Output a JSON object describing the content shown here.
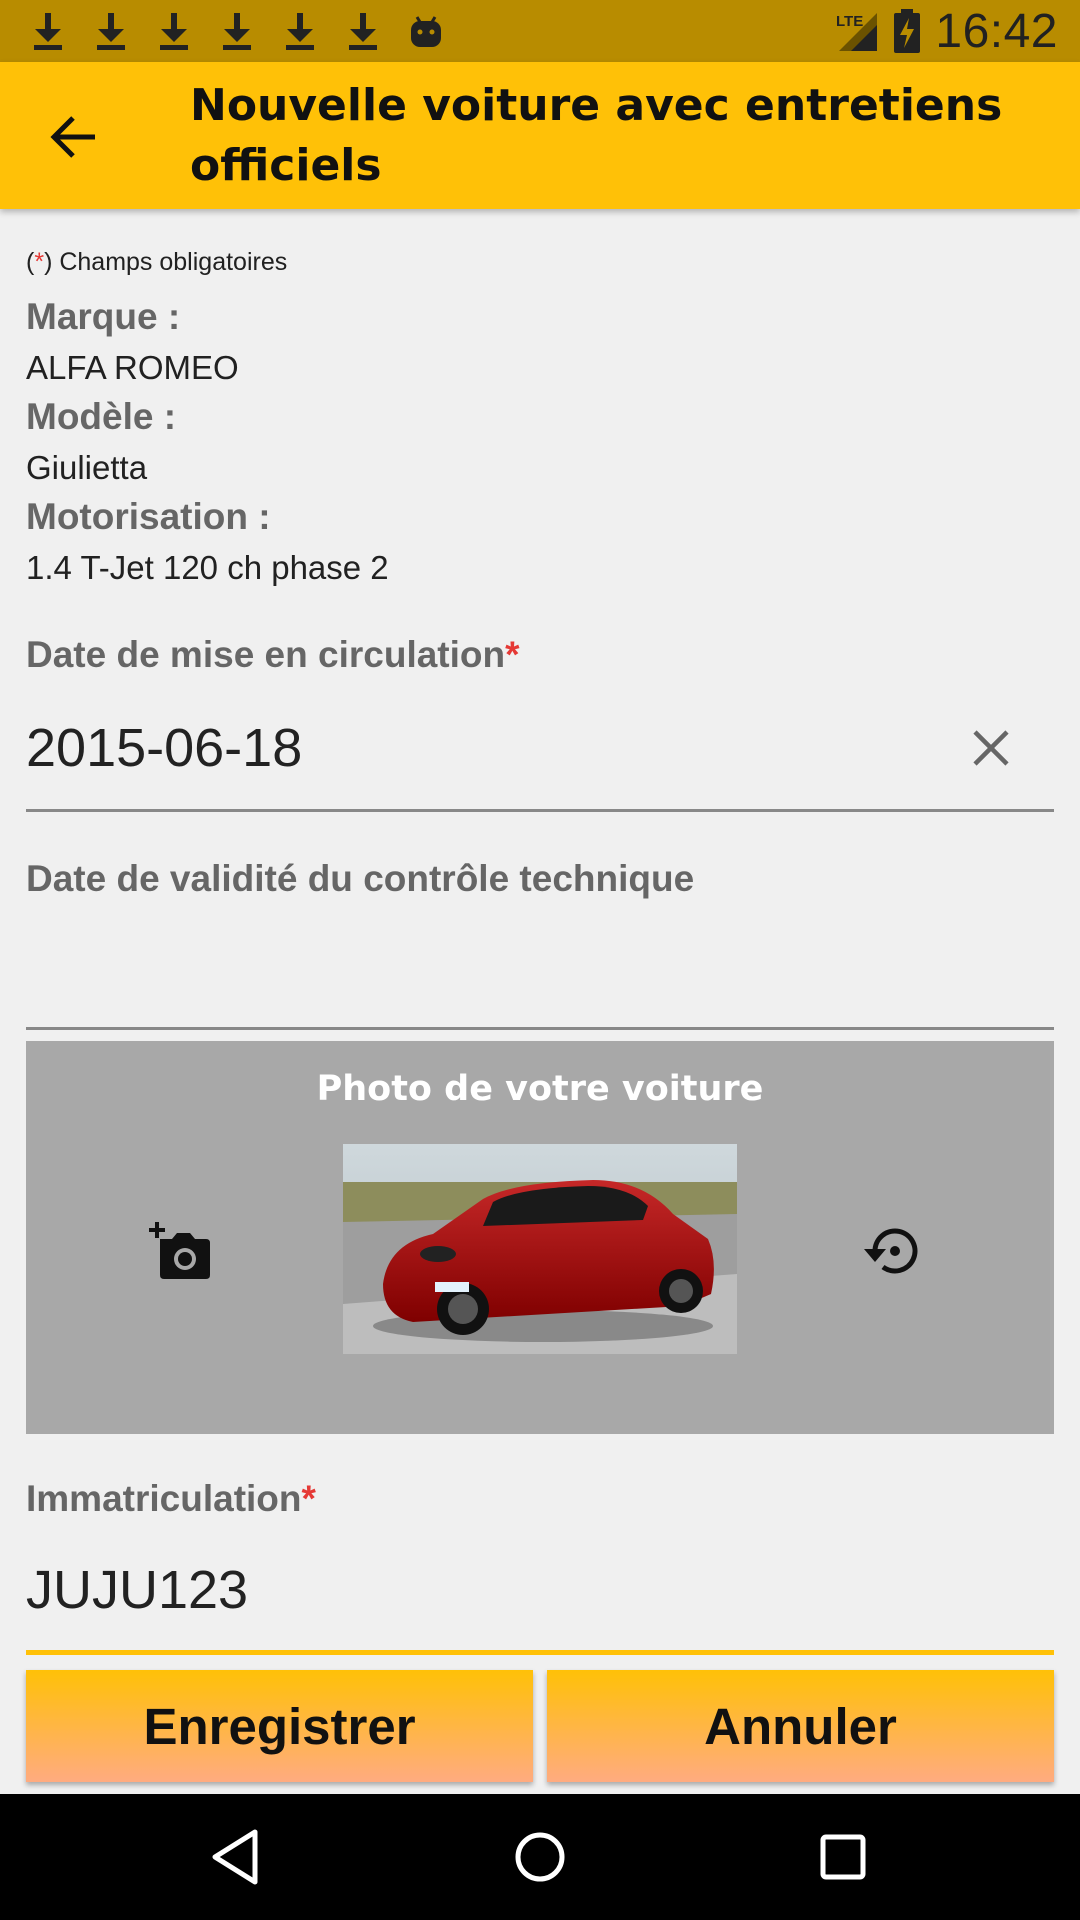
{
  "status_bar": {
    "time": "16:42",
    "network": "LTE",
    "icons": [
      "download-icon",
      "download-icon",
      "download-icon",
      "download-icon",
      "download-icon",
      "download-icon",
      "android-icon",
      "signal-icon",
      "battery-charging-icon"
    ]
  },
  "app_bar": {
    "title": "Nouvelle voiture avec entretiens officiels",
    "back_icon": "arrow-back-icon"
  },
  "form": {
    "mandatory_note": {
      "open": "(",
      "star": "*",
      "text": ") Champs obligatoires"
    },
    "brand": {
      "label": "Marque :",
      "value": "ALFA ROMEO"
    },
    "model": {
      "label": "Modèle :",
      "value": "Giulietta"
    },
    "engine": {
      "label": "Motorisation :",
      "value": "1.4 T-Jet 120 ch phase 2"
    },
    "registration_date": {
      "label": "Date de mise en circulation",
      "required_mark": "*",
      "value": "2015-06-18",
      "clear_icon": "close-icon"
    },
    "inspection_date": {
      "label": "Date de validité du contrôle technique",
      "value": ""
    },
    "photo": {
      "title": "Photo de votre voiture",
      "add_icon": "add-photo-icon",
      "reset_icon": "restore-icon"
    },
    "plate": {
      "label": "Immatriculation",
      "required_mark": "*",
      "value": "JUJU123"
    }
  },
  "actions": {
    "save_label": "Enregistrer",
    "cancel_label": "Annuler"
  },
  "nav_bar": {
    "icons": [
      "nav-back-icon",
      "nav-home-icon",
      "nav-recents-icon"
    ]
  },
  "colors": {
    "status_bar": "#b88c00",
    "app_bar": "#ffc107",
    "accent": "#ffc107",
    "required_star": "#e53935",
    "background": "#f0f0f0",
    "photo_panel": "#a8a8a8"
  }
}
